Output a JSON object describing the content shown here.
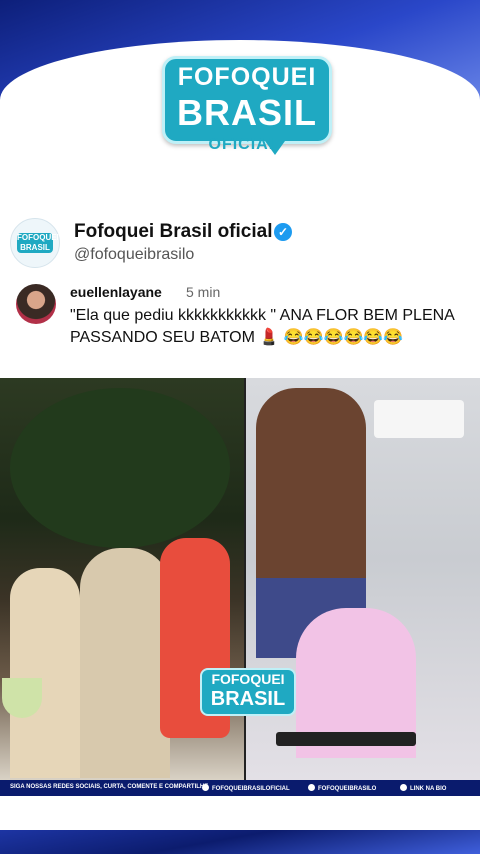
{
  "brand": {
    "line1": "FOFOQUEI",
    "line2": "BRASIL",
    "sub": "OFICIAL"
  },
  "account": {
    "name": "Fofoquei Brasil oficial",
    "handle": "@fofoqueibrasilo",
    "verified_mark": "✓",
    "avatar_text": "FOFOQUEI BRASIL"
  },
  "comment": {
    "user": "euellenlayane",
    "time": "5 min",
    "text": "\"Ela que pediu kkkkkkkkkkk \" ANA FLOR BEM PLENA PASSANDO SEU BATOM 💄 😂😂😂😂😂😂"
  },
  "watermark": {
    "line1": "FOFOQUEI",
    "line2": "BRASIL"
  },
  "footer": {
    "follow": "SIGA NOSSAS REDES SOCIAIS, CURTA, COMENTE E COMPARTILHE",
    "instagram": "FOFOQUEIBRASILOFICIAL",
    "twitter": "FOFOQUEIBRASILO",
    "link": "LINK NA BIO"
  },
  "colors": {
    "accent": "#1fa9c2",
    "brand_blue": "#1c2f8a",
    "verified": "#1d9bf0"
  }
}
